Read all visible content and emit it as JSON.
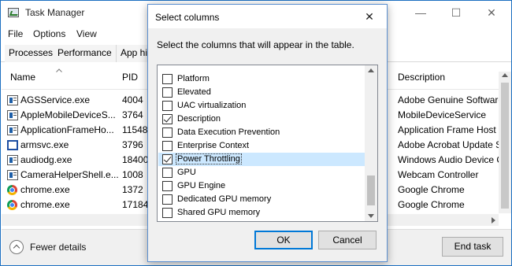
{
  "window": {
    "title": "Task Manager",
    "minimize": "—",
    "maximize": "☐",
    "close": "✕"
  },
  "menu": [
    "File",
    "Options",
    "View"
  ],
  "tabs": [
    "Processes",
    "Performance",
    "App hi"
  ],
  "columns": {
    "name": "Name",
    "pid": "PID",
    "description": "Description"
  },
  "processes": [
    {
      "name": "AGSService.exe",
      "pid": "4004",
      "description": "Adobe Genuine Software",
      "icon": "service-icon"
    },
    {
      "name": "AppleMobileDeviceS...",
      "pid": "3764",
      "description": "MobileDeviceService",
      "icon": "service-icon"
    },
    {
      "name": "ApplicationFrameHo...",
      "pid": "11548",
      "description": "Application Frame Host",
      "icon": "service-icon"
    },
    {
      "name": "armsvc.exe",
      "pid": "3796",
      "description": "Adobe Acrobat Update S",
      "icon": "window-icon"
    },
    {
      "name": "audiodg.exe",
      "pid": "18400",
      "description": "Windows Audio Device C",
      "icon": "service-icon"
    },
    {
      "name": "CameraHelperShell.e...",
      "pid": "1008",
      "description": "Webcam Controller",
      "icon": "service-icon"
    },
    {
      "name": "chrome.exe",
      "pid": "1372",
      "description": "Google Chrome",
      "icon": "chrome-icon"
    },
    {
      "name": "chrome.exe",
      "pid": "17184",
      "description": "Google Chrome",
      "icon": "chrome-icon"
    }
  ],
  "footer": {
    "fewer_details": "Fewer details",
    "end_task": "End task"
  },
  "dialog": {
    "title": "Select columns",
    "close": "✕",
    "instruction": "Select the columns that will appear in the table.",
    "options": [
      {
        "label": "Platform",
        "checked": false,
        "selected": false
      },
      {
        "label": "Elevated",
        "checked": false,
        "selected": false
      },
      {
        "label": "UAC virtualization",
        "checked": false,
        "selected": false
      },
      {
        "label": "Description",
        "checked": true,
        "selected": false
      },
      {
        "label": "Data Execution Prevention",
        "checked": false,
        "selected": false
      },
      {
        "label": "Enterprise Context",
        "checked": false,
        "selected": false
      },
      {
        "label": "Power Throttling",
        "checked": true,
        "selected": true
      },
      {
        "label": "GPU",
        "checked": false,
        "selected": false
      },
      {
        "label": "GPU Engine",
        "checked": false,
        "selected": false
      },
      {
        "label": "Dedicated GPU memory",
        "checked": false,
        "selected": false
      },
      {
        "label": "Shared GPU memory",
        "checked": false,
        "selected": false
      }
    ],
    "ok": "OK",
    "cancel": "Cancel"
  }
}
